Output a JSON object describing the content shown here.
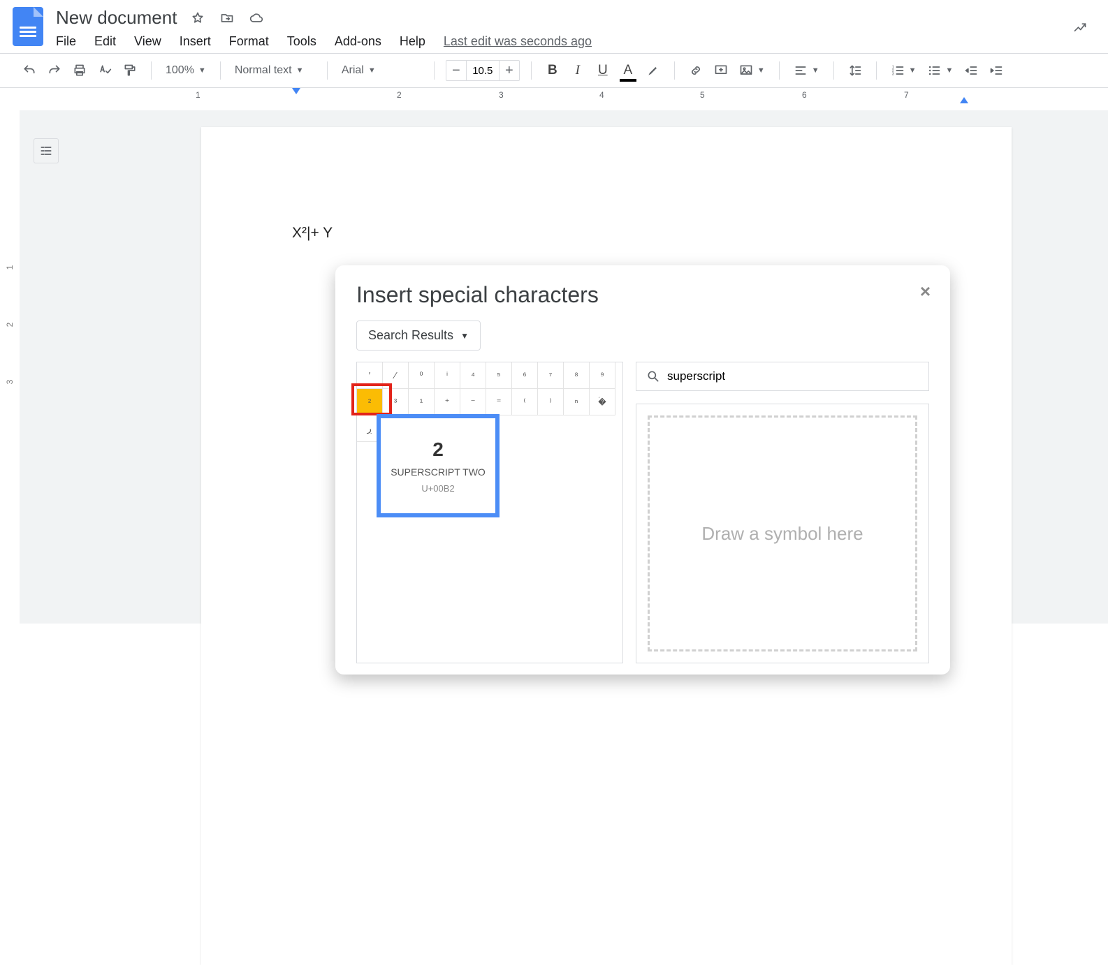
{
  "doc": {
    "title": "New document",
    "body": "X²|+ Y"
  },
  "menu": {
    "items": [
      "File",
      "Edit",
      "View",
      "Insert",
      "Format",
      "Tools",
      "Add-ons",
      "Help"
    ],
    "last_edit": "Last edit was seconds ago"
  },
  "toolbar": {
    "zoom": "100%",
    "style": "Normal text",
    "font": "Arial",
    "fontsize": "10.5"
  },
  "ruler": {
    "h": [
      "1",
      "2",
      "3",
      "4",
      "5",
      "6",
      "7"
    ],
    "v": [
      "1",
      "2",
      "3"
    ]
  },
  "dialog": {
    "title": "Insert special characters",
    "category": "Search Results",
    "search": "superscript",
    "draw_placeholder": "Draw a symbol here",
    "grid": [
      "′",
      "⁄",
      "⁰",
      "ⁱ",
      "⁴",
      "⁵",
      "⁶",
      "⁷",
      "⁸",
      "⁹",
      "²",
      "³",
      "¹",
      "⁺",
      "⁻",
      "⁼",
      "⁽",
      "⁾",
      "ⁿ",
      "�ۤ",
      "ڔ",
      "",
      "",
      "",
      "",
      "",
      "",
      "",
      "",
      ""
    ],
    "selected_index": 10,
    "preview": {
      "glyph": "2",
      "name": "SUPERSCRIPT TWO",
      "code": "U+00B2"
    }
  }
}
